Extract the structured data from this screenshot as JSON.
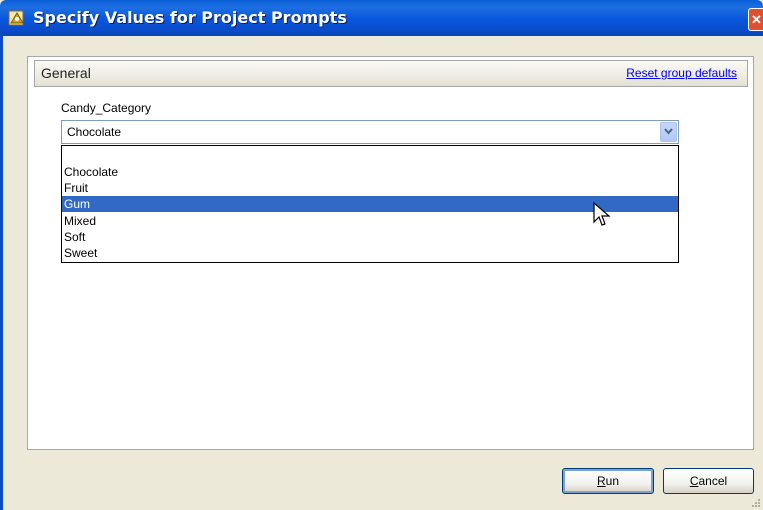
{
  "window": {
    "title": "Specify Values for Project Prompts",
    "close_icon": "close-icon",
    "app_icon": "project-prompts-app-icon"
  },
  "group": {
    "title": "General",
    "reset_link": "Reset group defaults"
  },
  "prompt": {
    "label": "Candy_Category",
    "selected_value": "Chocolate",
    "dropdown_open": true,
    "options": [
      "",
      "Chocolate",
      "Fruit",
      "Gum",
      "Mixed",
      "Soft",
      "Sweet"
    ],
    "highlighted_option": "Gum"
  },
  "buttons": {
    "run": "Run",
    "run_mnemonic": "R",
    "cancel": "Cancel",
    "cancel_mnemonic": "C"
  },
  "colors": {
    "titlebar": "#0A5FD6",
    "selection": "#316AC5",
    "link": "#0000EE",
    "dialog_bg": "#ECE9D8"
  }
}
